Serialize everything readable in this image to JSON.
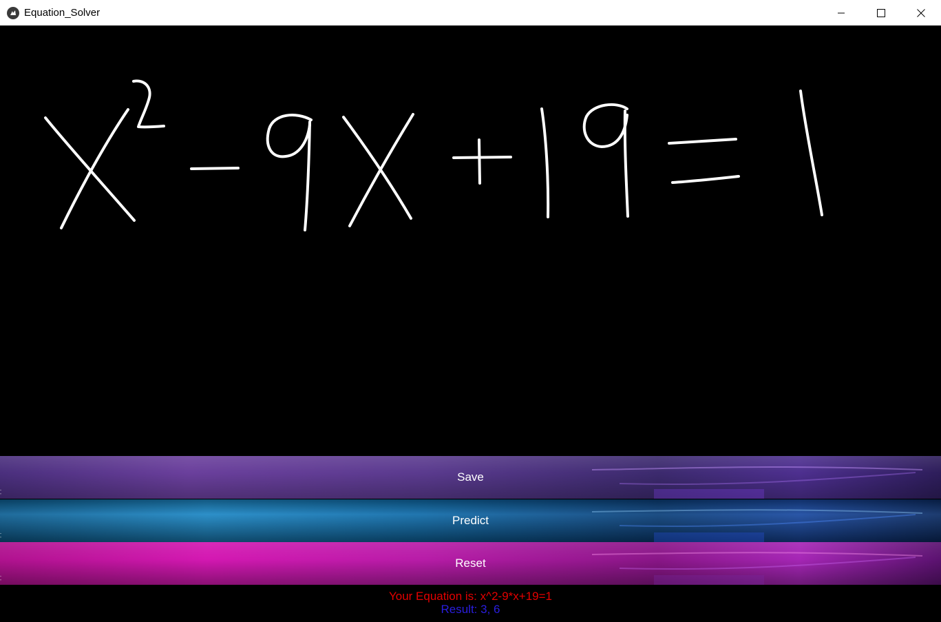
{
  "window": {
    "title": "Equation_Solver",
    "icon": "kivy-app-icon",
    "controls": [
      "minimize-icon",
      "maximize-icon",
      "close-icon"
    ]
  },
  "canvas": {
    "description_icon": "handwriting-canvas",
    "stroke_color": "#ffffff",
    "background_color": "#000000"
  },
  "buttons": {
    "save_label": "Save",
    "predict_label": "Predict",
    "reset_label": "Reset",
    "mark": "Fr"
  },
  "output": {
    "equation_text": "Your Equation is: x^2-9*x+19=1",
    "result_text": "Result: 3, 6",
    "equation_color": "#e50000",
    "result_color": "#2a1ee0"
  }
}
